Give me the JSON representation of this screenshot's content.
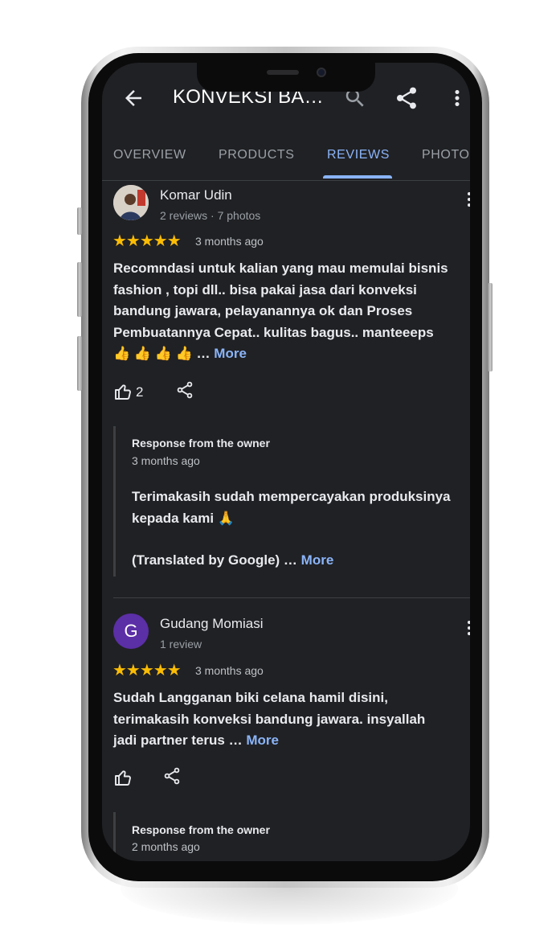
{
  "app": {
    "title": "KONVEKSI BA…"
  },
  "tabs": [
    {
      "label": "OVERVIEW",
      "active": false
    },
    {
      "label": "PRODUCTS",
      "active": false
    },
    {
      "label": "REVIEWS",
      "active": true
    },
    {
      "label": "PHOTOS",
      "active": false
    }
  ],
  "reviews": [
    {
      "author": "Komar Udin",
      "meta": "2 reviews · 7 photos",
      "stars": "★★★★★",
      "rating": 5,
      "time": "3 months ago",
      "text": "Recomndasi untuk kalian yang mau memulai bisnis fashion , topi dll.. bisa pakai jasa dari konveksi bandung jawara, pelayanannya ok dan Proses Pembuatannya Cepat.. kulitas bagus.. manteeeps 👍 👍 👍 👍 …",
      "more_label": "More",
      "likes": "2",
      "owner_response": {
        "title": "Response from the owner",
        "time": "3 months ago",
        "text": "Terimakasih sudah mempercayakan produksinya kepada kami 🙏",
        "translated": "(Translated by Google) …",
        "more_label": "More"
      }
    },
    {
      "author": "Gudang Momiasi",
      "avatar_letter": "G",
      "meta": "1 review",
      "stars": "★★★★★",
      "rating": 5,
      "time": "3 months ago",
      "text": "Sudah Langganan biki celana hamil disini, terimakasih konveksi bandung jawara. insyallah jadi partner terus …",
      "more_label": "More",
      "owner_response": {
        "title": "Response from the owner",
        "time": "2 months ago"
      }
    }
  ],
  "colors": {
    "background": "#202124",
    "accent": "#8ab4f8",
    "star": "#fbbc04",
    "text": "#e8eaed",
    "secondary_text": "#9aa0a6",
    "avatar_letter_bg": "#5b2fa6"
  },
  "icons": {
    "back": "arrow-left-icon",
    "search": "search-icon",
    "share": "share-icon",
    "menu": "more-vert-icon",
    "like": "thumbs-up-icon"
  }
}
